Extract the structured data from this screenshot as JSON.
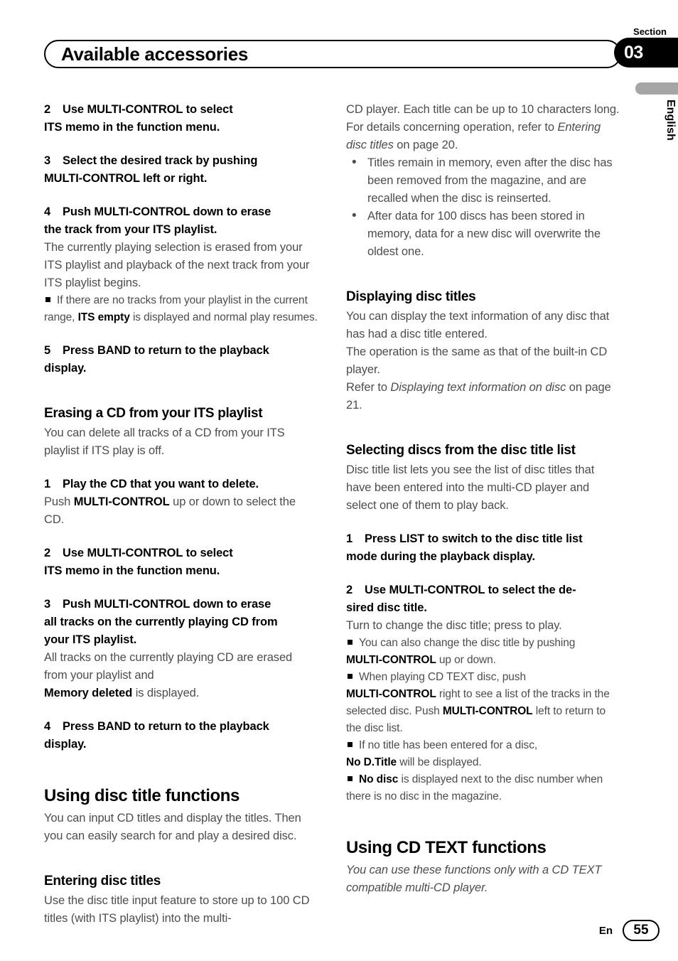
{
  "header": {
    "section_label": "Section",
    "section_number": "03",
    "title": "Available accessories"
  },
  "side": {
    "language": "English"
  },
  "footer": {
    "language_code": "En",
    "page_number": "55"
  },
  "left_column": {
    "step2_num": "2",
    "step2_text": "Use MULTI-CONTROL to select",
    "step2_text2": "ITS memo in the function menu.",
    "step3_num": "3",
    "step3_text": "Select the desired track by pushing",
    "step3_text2": "MULTI-CONTROL left or right.",
    "step4_num": "4",
    "step4_text": "Push MULTI-CONTROL down to erase",
    "step4_text2": "the track from your ITS playlist.",
    "step4_body": "The currently playing selection is erased from your ITS playlist and playback of the next track from your ITS playlist begins.",
    "note1_a": "If there are no tracks from your playlist in the current range, ",
    "note1_b": "ITS empty",
    "note1_c": " is displayed and normal play resumes.",
    "step5_num": "5",
    "step5_text": "Press BAND to return to the playback",
    "step5_text2": "display.",
    "heading_erasing": "Erasing a CD from your ITS playlist",
    "erasing_body": "You can delete all tracks of a CD from your ITS playlist if ITS play is off.",
    "e_step1_num": "1",
    "e_step1_text": "Play the CD that you want to delete.",
    "e_step1_body_a": "Push ",
    "e_step1_body_b": "MULTI-CONTROL",
    "e_step1_body_c": " up or down to select the CD.",
    "e_step2_num": "2",
    "e_step2_text": "Use MULTI-CONTROL to select",
    "e_step2_text2": "ITS memo in the function menu.",
    "e_step3_num": "3",
    "e_step3_text": "Push MULTI-CONTROL down to erase",
    "e_step3_text2": "all tracks on the currently playing CD from",
    "e_step3_text3": "your ITS playlist.",
    "e_step3_body_a": "All tracks on the currently playing CD are erased from your playlist and",
    "e_step3_body_b": "Memory deleted",
    "e_step3_body_c": " is displayed.",
    "e_step4_num": "4",
    "e_step4_text": "Press BAND to return to the playback",
    "e_step4_text2": "display.",
    "heading_using_disc_title": "Using disc title functions",
    "using_disc_title_body": "You can input CD titles and display the titles. Then you can easily search for and play a desired disc.",
    "heading_entering": "Entering disc titles",
    "entering_body": "Use the disc title input feature to store up to 100 CD titles  (with ITS playlist) into the multi-"
  },
  "right_column": {
    "cont_body_a": "CD player. Each title can be up to 10 characters long.",
    "cont_body_b1": "For details concerning operation, refer to ",
    "cont_body_b2": "Entering disc titles",
    "cont_body_b3": " on page 20.",
    "bullet1": "Titles remain in memory, even after the disc has been removed from the magazine, and are recalled when the disc is reinserted.",
    "bullet2": "After data for 100 discs has been stored in memory, data for a new disc will overwrite the oldest one.",
    "heading_displaying": "Displaying disc titles",
    "displaying_body_a": "You can display the text information of any disc that has had a disc title entered.",
    "displaying_body_b": "The operation is the same as that of the built-in CD player.",
    "displaying_body_c1": "Refer to ",
    "displaying_body_c2": "Displaying text information on disc",
    "displaying_body_c3": " on page 21.",
    "heading_selecting": "Selecting discs from the disc title list",
    "selecting_body": "Disc title list lets you see the list of disc titles that have been entered into the multi-CD player and select one of them to play back.",
    "s_step1_num": "1",
    "s_step1_text": "Press LIST to switch to the disc title list",
    "s_step1_text2": "mode during the playback display.",
    "s_step2_num": "2",
    "s_step2_text": "Use MULTI-CONTROL to select the de-",
    "s_step2_text2": "sired disc title.",
    "s_step2_body": "Turn to change the disc title; press to play.",
    "note_a1": "You can also change the disc title by pushing ",
    "note_a2": "MULTI-CONTROL",
    "note_a3": " up or down.",
    "note_b1": "When playing CD TEXT disc, push ",
    "note_b2": "MULTI-CONTROL",
    "note_b3": " right to see a list of the tracks in the selected disc. Push ",
    "note_b4": "MULTI-CONTROL",
    "note_b5": " left to return to the disc list.",
    "note_c1": "If no title has been entered for a disc, ",
    "note_c2": "No D.Title",
    "note_c3": " will be displayed.",
    "note_d1": "No disc",
    "note_d2": " is displayed next to the disc number when there is no disc in the magazine.",
    "heading_cd_text": "Using CD TEXT functions",
    "cd_text_body": "You can use these functions only with a CD TEXT compatible multi-CD player."
  }
}
